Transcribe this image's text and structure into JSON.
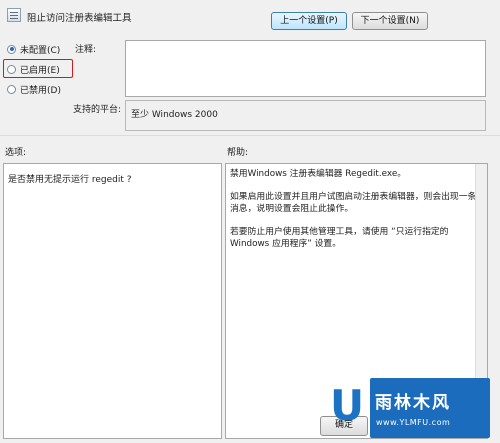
{
  "window": {
    "title": "阻止访问注册表编辑工具"
  },
  "nav": {
    "prev_label": "上一个设置(P)",
    "next_label": "下一个设置(N)"
  },
  "state_options": [
    {
      "label": "未配置(C)",
      "checked": true
    },
    {
      "label": "已启用(E)",
      "checked": false
    },
    {
      "label": "已禁用(D)",
      "checked": false
    }
  ],
  "fields": {
    "notes_label": "注释:",
    "platform_label": "支持的平台:",
    "platform_value": "至少 Windows 2000"
  },
  "options": {
    "label": "选项:",
    "text": "是否禁用无提示运行 regedit ?"
  },
  "help": {
    "label": "帮助:",
    "paragraphs": [
      "禁用Windows 注册表编辑器 Regedit.exe。",
      "如果启用此设置并且用户试图启动注册表编辑器，则会出现一条消息，说明设置会阻止此操作。",
      "若要防止用户使用其他管理工具，请使用 “只运行指定的 Windows 应用程序” 设置。"
    ]
  },
  "footer": {
    "ok_label": "确定"
  },
  "watermark": {
    "letter": "U",
    "title": "雨林木风",
    "url": "www.YLMFU.com"
  },
  "colors": {
    "highlight": "#d21a1a",
    "watermark_blue": "#1b6cbd"
  }
}
